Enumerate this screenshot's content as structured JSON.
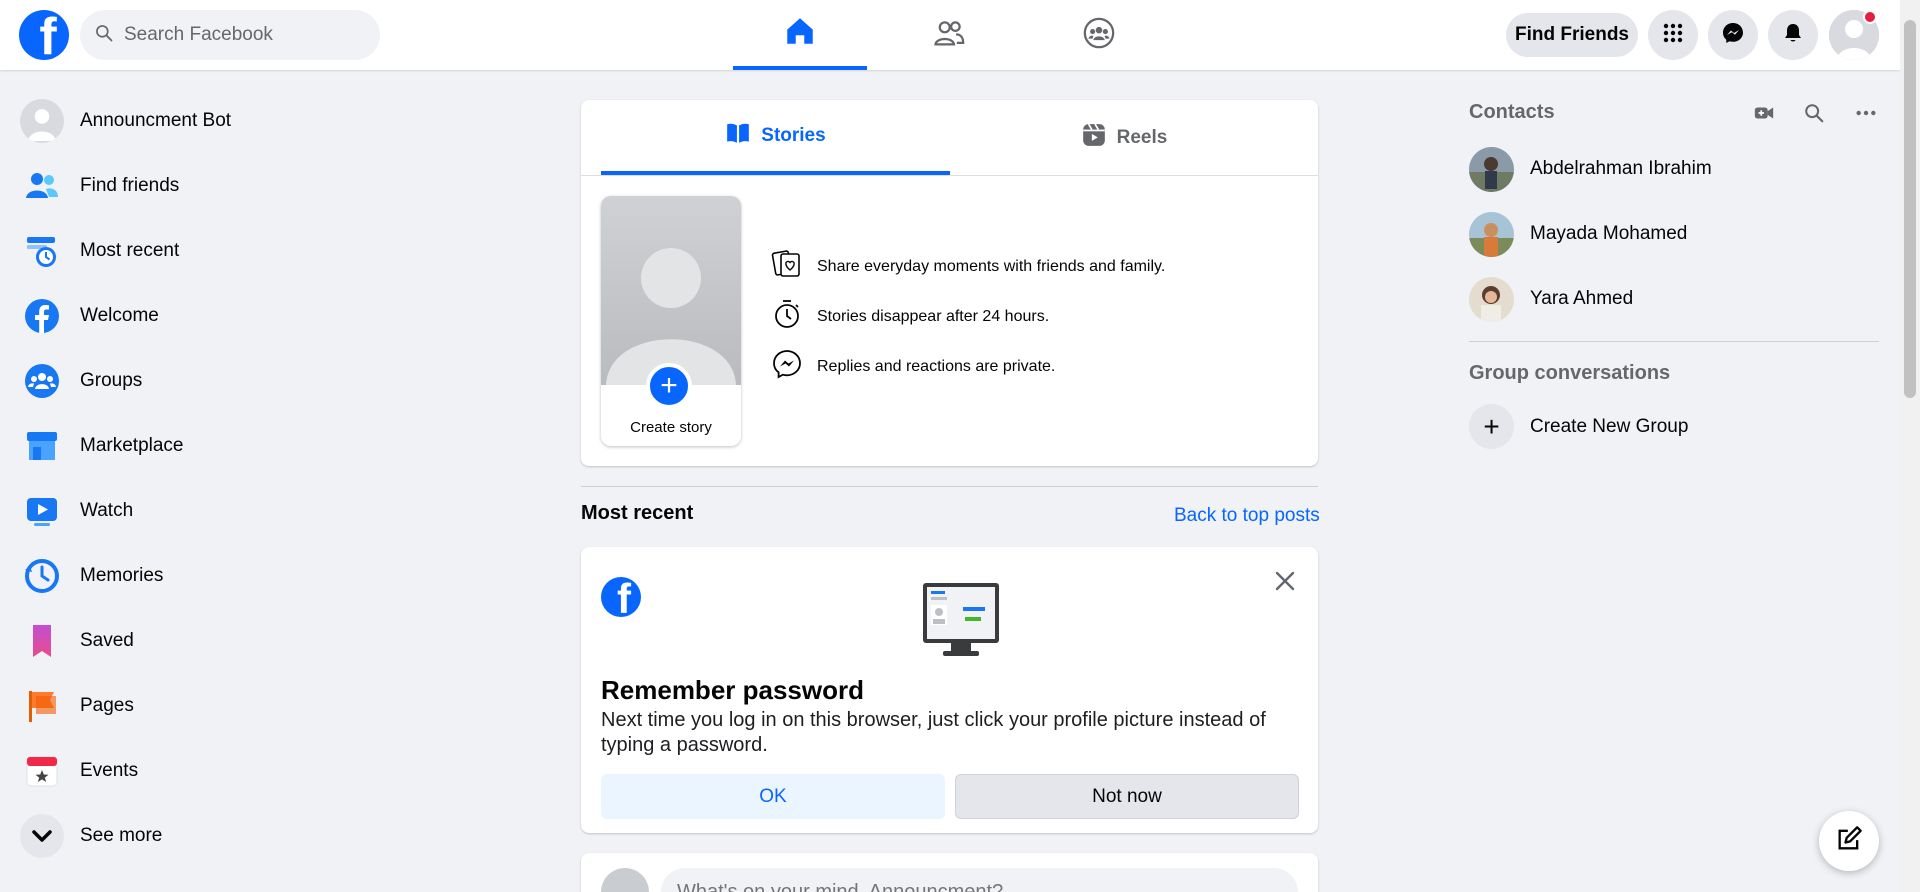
{
  "search": {
    "placeholder": "Search Facebook"
  },
  "topbar": {
    "logo_letter": "f",
    "find_friends_label": "Find Friends",
    "nav_tabs": [
      {
        "name": "home",
        "icon": "home-icon",
        "active": true
      },
      {
        "name": "friends",
        "icon": "friends-icon",
        "active": false
      },
      {
        "name": "groups",
        "icon": "groups-icon",
        "active": false
      }
    ]
  },
  "sidebar": {
    "items": [
      {
        "label": "Announcment Bot",
        "icon": "profile-avatar"
      },
      {
        "label": "Find friends",
        "icon": "friends-icon"
      },
      {
        "label": "Most recent",
        "icon": "feeds-clock-icon"
      },
      {
        "label": "Welcome",
        "icon": "facebook-icon"
      },
      {
        "label": "Groups",
        "icon": "groups-icon"
      },
      {
        "label": "Marketplace",
        "icon": "marketplace-icon"
      },
      {
        "label": "Watch",
        "icon": "watch-icon"
      },
      {
        "label": "Memories",
        "icon": "memories-icon"
      },
      {
        "label": "Saved",
        "icon": "saved-icon"
      },
      {
        "label": "Pages",
        "icon": "pages-flag-icon"
      },
      {
        "label": "Events",
        "icon": "events-icon"
      },
      {
        "label": "See more",
        "icon": "chevron-down-icon"
      }
    ]
  },
  "stories": {
    "tabs": [
      {
        "label": "Stories",
        "active": true
      },
      {
        "label": "Reels",
        "active": false
      }
    ],
    "create_label": "Create story",
    "info": [
      "Share everyday moments with friends and family.",
      "Stories disappear after 24 hours.",
      "Replies and reactions are private."
    ]
  },
  "feed": {
    "section_title": "Most recent",
    "back_link": "Back to top posts"
  },
  "password_card": {
    "title": "Remember password",
    "description": "Next time you log in on this browser, just click your profile picture instead of typing a password.",
    "ok_label": "OK",
    "not_now_label": "Not now"
  },
  "composer": {
    "placeholder": "What's on your mind, Announcment?"
  },
  "contacts": {
    "title": "Contacts",
    "people": [
      {
        "name": "Abdelrahman Ibrahim"
      },
      {
        "name": "Mayada Mohamed"
      },
      {
        "name": "Yara Ahmed"
      }
    ],
    "group_title": "Group conversations",
    "create_group_label": "Create New Group"
  },
  "colors": {
    "brand": "#0866ff",
    "notification": "#e41e3f",
    "background": "#f0f2f5"
  }
}
